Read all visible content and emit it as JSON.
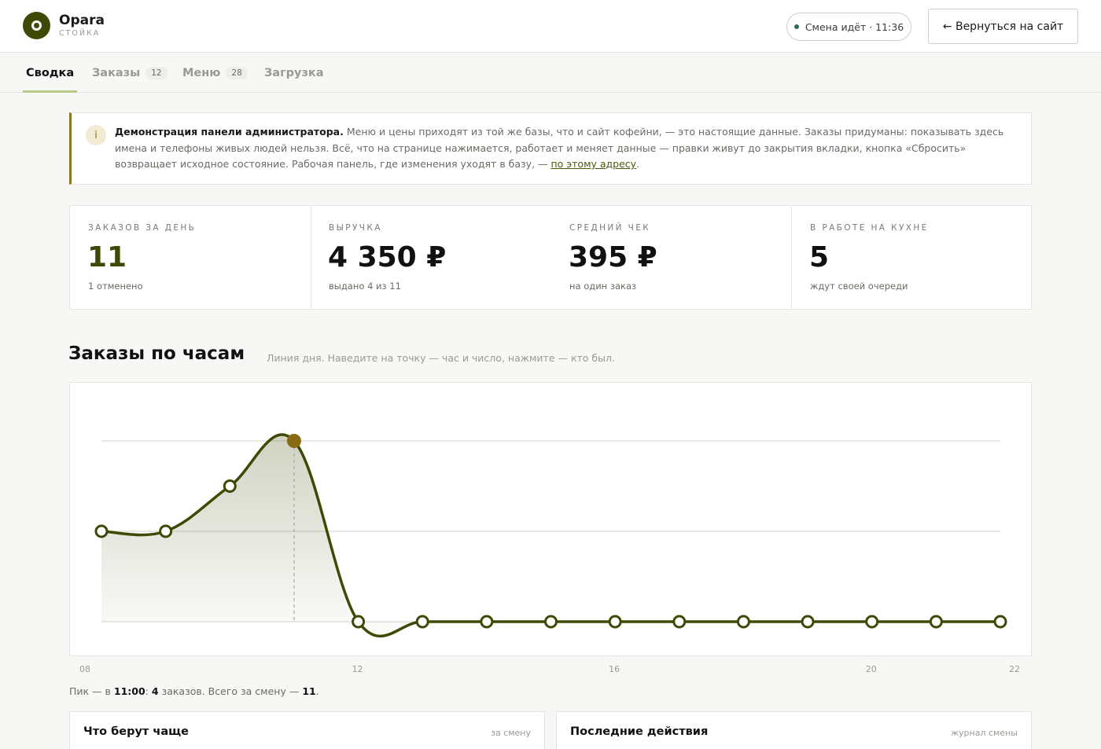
{
  "brand": {
    "name": "Opara",
    "subtitle": "СТОЙКА"
  },
  "header": {
    "shift_status": "Смена идёт · 11:36",
    "back_label": "← Вернуться на сайт"
  },
  "tabs": [
    {
      "label": "Сводка",
      "count": null,
      "active": true
    },
    {
      "label": "Заказы",
      "count": "12",
      "active": false
    },
    {
      "label": "Меню",
      "count": "28",
      "active": false
    },
    {
      "label": "Загрузка",
      "count": null,
      "active": false
    }
  ],
  "notice": {
    "icon": "i",
    "title": "Демонстрация панели администратора.",
    "text": "Меню и цены приходят из той же базы, что и сайт кофейни, — это настоящие данные. Заказы придуманы: показывать здесь имена и телефоны живых людей нельзя. Всё, что на странице нажимается, работает и меняет данные — правки живут до закрытия вкладки, кнопка «Сбросить» возвращает исходное состояние. Рабочая панель, где изменения уходят в базу, —",
    "link": "по этому адресу",
    "tail": "."
  },
  "stats": [
    {
      "label": "ЗАКАЗОВ ЗА ДЕНЬ",
      "value": "11",
      "sub": "1 отменено"
    },
    {
      "label": "ВЫРУЧКА",
      "value": "4 350 ₽",
      "sub": "выдано 4 из 11"
    },
    {
      "label": "СРЕДНИЙ ЧЕК",
      "value": "395 ₽",
      "sub": "на один заказ"
    },
    {
      "label": "В РАБОТЕ НА КУХНЕ",
      "value": "5",
      "sub": "ждут своей очереди"
    }
  ],
  "section": {
    "title": "Заказы по часам",
    "hint": "Линия дня. Наведите на точку — час и число, нажмите — кто был."
  },
  "chart_data": {
    "type": "area",
    "x": [
      8,
      9,
      10,
      11,
      12,
      13,
      14,
      15,
      16,
      17,
      18,
      19,
      20,
      21,
      22
    ],
    "values": [
      2,
      2,
      3,
      4,
      0,
      0,
      0,
      0,
      0,
      0,
      0,
      0,
      0,
      0,
      0
    ],
    "x_tick_labels": [
      "08",
      "12",
      "16",
      "20",
      "22"
    ],
    "x_tick_values": [
      8,
      12,
      16,
      20,
      22
    ],
    "ylim": [
      0,
      4
    ],
    "grid": true,
    "peak_index": 3,
    "colors": {
      "line": "#3d4a06",
      "peak": "#8a6a12",
      "grid": "#e2e2dc"
    }
  },
  "peak_note": {
    "prefix": "Пик — в",
    "hour": "11:00",
    "colon": ":",
    "count": "4",
    "mid": "заказов. Всего за смену —",
    "total": "11",
    "end": "."
  },
  "cards": [
    {
      "title": "Что берут чаще",
      "hint": "за смену"
    },
    {
      "title": "Последние действия",
      "hint": "журнал смены"
    }
  ]
}
